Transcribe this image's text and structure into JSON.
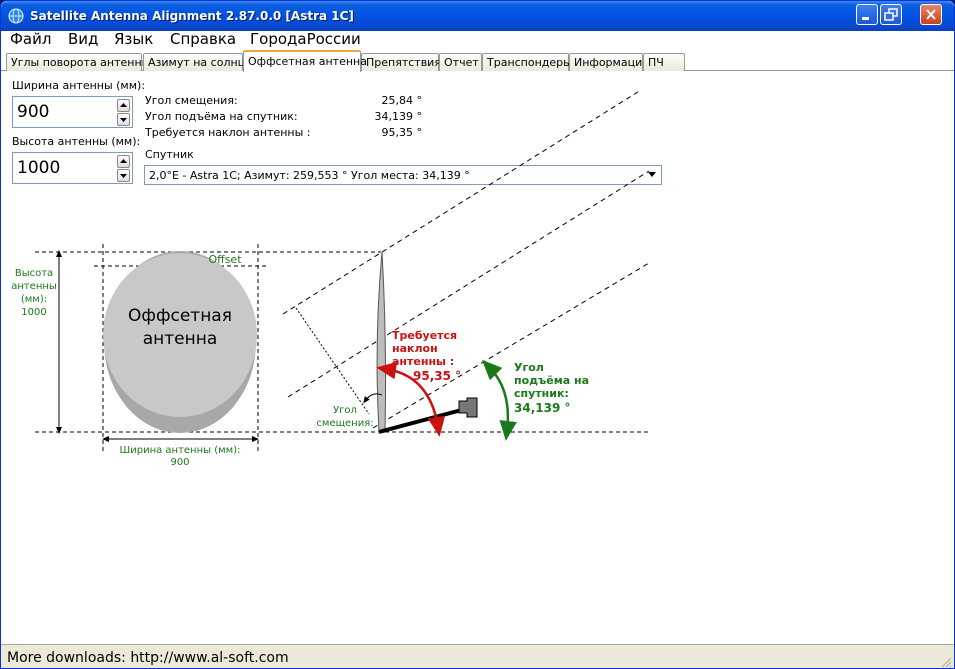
{
  "window": {
    "title": "Satellite Antenna Alignment 2.87.0.0 [Astra 1C]"
  },
  "menu": {
    "items": [
      "Файл",
      "Вид",
      "Язык",
      "Справка",
      "ГородаРоссии"
    ]
  },
  "tabs": [
    {
      "label": "Углы поворота антенны",
      "active": false
    },
    {
      "label": "Азимут на солнце",
      "active": false
    },
    {
      "label": "Оффсетная антенна",
      "active": true
    },
    {
      "label": "Препятствия",
      "active": false
    },
    {
      "label": "Отчет",
      "active": false
    },
    {
      "label": "Транспондеры",
      "active": false
    },
    {
      "label": "Информация",
      "active": false
    },
    {
      "label": "ПЧ",
      "active": false
    }
  ],
  "antenna": {
    "width_label": "Ширина антенны (мм):",
    "width_value": "900",
    "height_label": "Высота антенны (мм):",
    "height_value": "1000"
  },
  "results": {
    "offset_angle_label": "Угол смещения:",
    "offset_angle_value": "25,84 °",
    "elevation_label": "Угол подъёма на спутник:",
    "elevation_value": "34,139 °",
    "tilt_label": "Требуется наклон антенны :",
    "tilt_value": "95,35 °"
  },
  "satellite": {
    "label": "Спутник",
    "selected": "2,0°E - Astra 1C;  Азимут: 259,553 °  Угол места: 34,139 °"
  },
  "diagram": {
    "offset_label": "Offset",
    "dish_title_line1": "Оффсетная",
    "dish_title_line2": "антенна",
    "height_line1": "Высота",
    "height_line2": "антенны",
    "height_line3": "(мм):",
    "height_value": "1000",
    "width_line1": "Ширина антенны (мм):",
    "width_value": "900",
    "offset_angle_line1": "Угол",
    "offset_angle_line2": "смещения:",
    "tilt_line1": "Требуется",
    "tilt_line2": "наклон",
    "tilt_line3": "антенны :",
    "tilt_value": "95,35 °",
    "elev_line1": "Угол",
    "elev_line2": "подъёма на",
    "elev_line3": "спутник:",
    "elev_value": "34,139 °",
    "colors": {
      "green": "#1a7a1a",
      "red": "#cc1111",
      "dish": "#c8c8c8",
      "dish_dark": "#a8a8a8"
    }
  },
  "status": {
    "text": "More downloads: http://www.al-soft.com"
  }
}
